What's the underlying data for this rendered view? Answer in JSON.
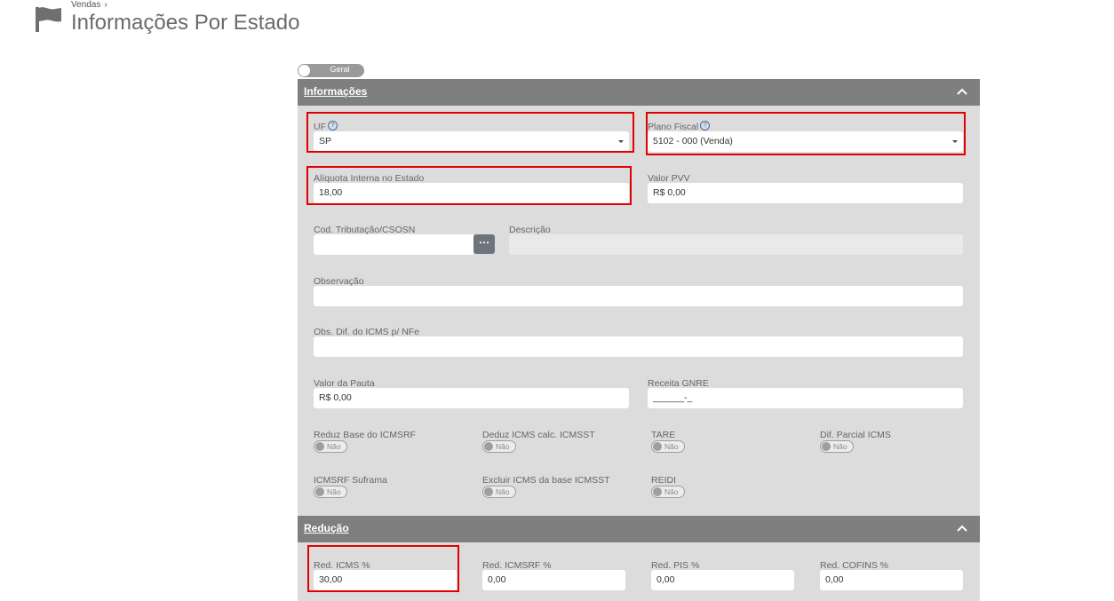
{
  "header": {
    "breadcrumb": "Vendas",
    "breadcrumb_sep": "›",
    "title": "Informações Por Estado",
    "icon": "flag-icon"
  },
  "toggle_geral": {
    "label": "Geral"
  },
  "informacoes": {
    "title": "Informações",
    "uf": {
      "label": "UF",
      "value": "SP"
    },
    "plano_fiscal": {
      "label": "Plano Fiscal",
      "value": "5102 - 000 (Venda)"
    },
    "aliquota": {
      "label": "Alíquota Interna no Estado",
      "value": "18,00"
    },
    "valor_pvv": {
      "label": "Valor PVV",
      "value": "R$ 0,00"
    },
    "cod_tributacao": {
      "label": "Cod. Tributação/CSOSN",
      "value": "",
      "button": "⋯"
    },
    "descricao": {
      "label": "Descrição",
      "value": ""
    },
    "observacao": {
      "label": "Observação",
      "value": ""
    },
    "obs_dif_icms": {
      "label": "Obs. Dif. do ICMS p/ NFe",
      "value": ""
    },
    "valor_pauta": {
      "label": "Valor da Pauta",
      "value": "R$ 0,00"
    },
    "receita_gnre": {
      "label": "Receita GNRE",
      "value": "______-_"
    },
    "switches": [
      {
        "label": "Reduz Base do ICMSRF",
        "state": "Não"
      },
      {
        "label": "Deduz ICMS calc. ICMSST",
        "state": "Não"
      },
      {
        "label": "TARE",
        "state": "Não"
      },
      {
        "label": "Dif. Parcial ICMS",
        "state": "Não"
      },
      {
        "label": "ICMSRF Suframa",
        "state": "Não"
      },
      {
        "label": "Excluir ICMS da base ICMSST",
        "state": "Não"
      },
      {
        "label": "REIDI",
        "state": "Não"
      }
    ]
  },
  "reducao": {
    "title": "Redução",
    "red_icms": {
      "label": "Red. ICMS %",
      "value": "30,00"
    },
    "red_icmsrf": {
      "label": "Red. ICMSRF %",
      "value": "0,00"
    },
    "red_pis": {
      "label": "Red. PIS %",
      "value": "0,00"
    },
    "red_cofins": {
      "label": "Red. COFINS %",
      "value": "0,00"
    }
  },
  "colors": {
    "header_bar": "#7f7f7f",
    "panel": "#dcdcdc",
    "highlight": "#e00000",
    "help": "#3a6fb0"
  }
}
